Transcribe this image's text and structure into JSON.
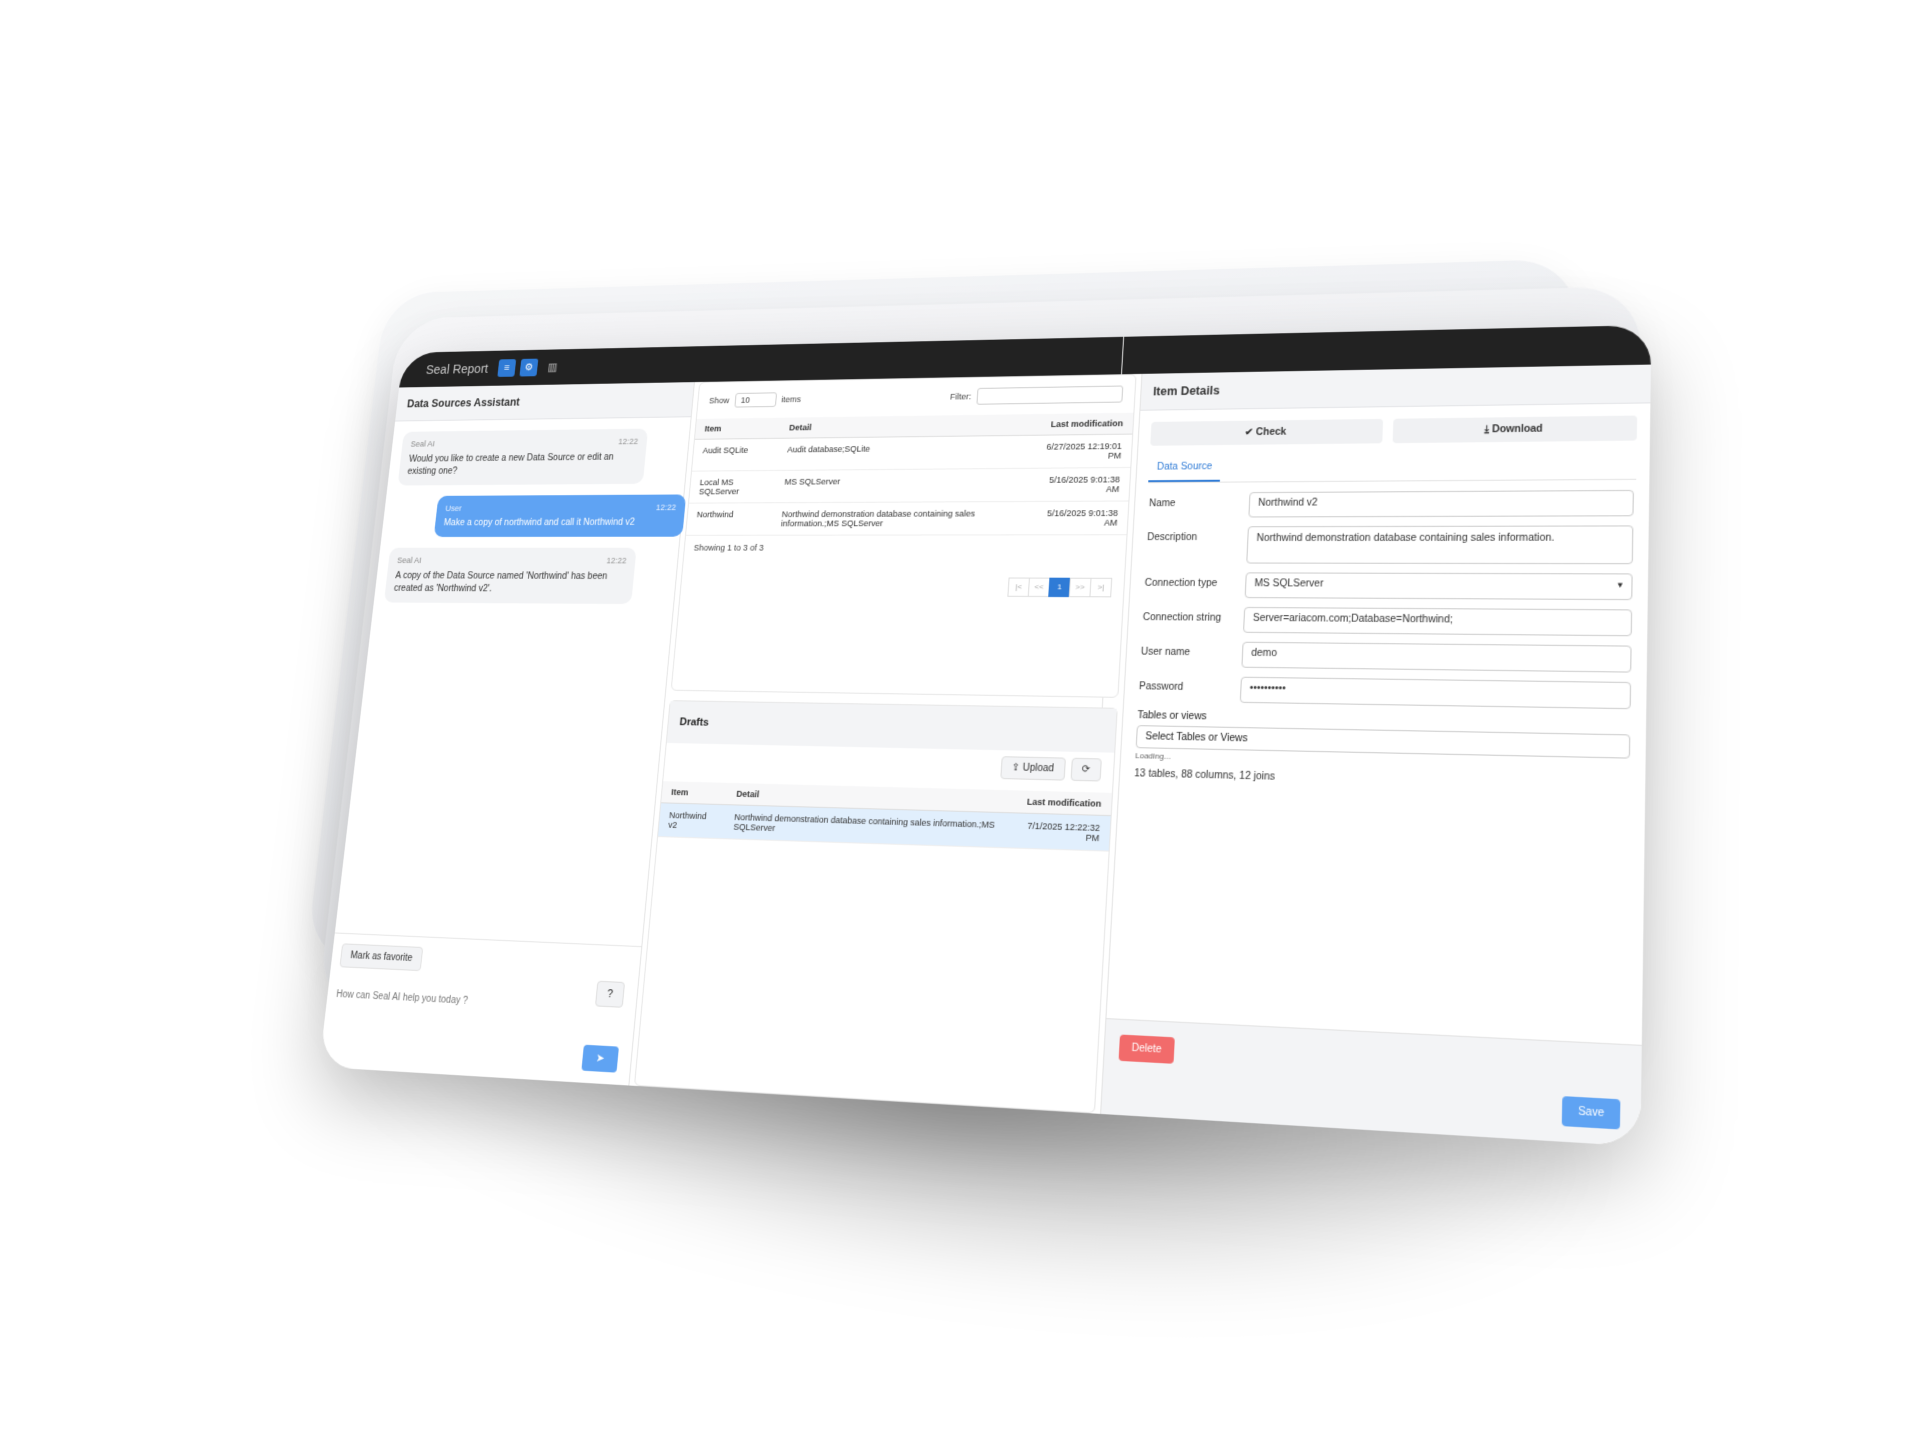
{
  "app": {
    "title": "Seal Report",
    "topbar_buttons": [
      "≡",
      "⚙"
    ],
    "topbar_chart_icon": "bar-chart-icon",
    "right_icons": [
      "info-icon",
      "logout-icon"
    ]
  },
  "assistant": {
    "title": "Data Sources Assistant",
    "messages": [
      {
        "who": "Seal AI",
        "time": "12:22",
        "text": "Would you like to create a new Data Source or edit an existing one?"
      },
      {
        "who": "User",
        "time": "12:22",
        "text": "Make a copy of northwind and call it Northwind v2"
      },
      {
        "who": "Seal AI",
        "time": "12:22",
        "text": "A copy of the Data Source named 'Northwind' has been created as 'Northwind v2'."
      }
    ],
    "favorite_label": "Mark as favorite",
    "prompt_placeholder": "How can Seal AI help you today ?",
    "help_icon": "?",
    "send_icon": "➤"
  },
  "sources": {
    "show_label": "Show",
    "page_size": "10",
    "items_label": "items",
    "filter_label": "Filter:",
    "columns": [
      "Item",
      "Detail",
      "Last modification"
    ],
    "rows": [
      {
        "item": "Audit SQLite",
        "detail": "Audit database;SQLite",
        "modified": "6/27/2025 12:19:01 PM"
      },
      {
        "item": "Local MS SQLServer",
        "detail": "MS SQLServer",
        "modified": "5/16/2025 9:01:38 AM"
      },
      {
        "item": "Northwind",
        "detail": "Northwind demonstration database containing sales information.;MS SQLServer",
        "modified": "5/16/2025 9:01:38 AM"
      }
    ],
    "showing": "Showing 1 to 3 of 3",
    "pager": [
      "|<",
      "<<",
      "1",
      ">>",
      ">|"
    ]
  },
  "drafts": {
    "title": "Drafts",
    "upload_label": "Upload",
    "refresh_icon": "⟳",
    "columns": [
      "Item",
      "Detail",
      "Last modification"
    ],
    "rows": [
      {
        "item": "Northwind v2",
        "detail": "Northwind demonstration database containing sales information.;MS SQLServer",
        "modified": "7/1/2025 12:22:32 PM"
      }
    ]
  },
  "details": {
    "title": "Item Details",
    "check_label": "Check",
    "download_label": "Download",
    "tab_label": "Data Source",
    "fields": {
      "name_label": "Name",
      "name_value": "Northwind v2",
      "desc_label": "Description",
      "desc_value": "Northwind demonstration database containing sales information.",
      "conn_type_label": "Connection type",
      "conn_type_value": "MS SQLServer",
      "conn_string_label": "Connection string",
      "conn_string_value": "Server=ariacom.com;Database=Northwind;",
      "user_label": "User name",
      "user_value": "demo",
      "password_label": "Password",
      "password_value": "••••••••••",
      "tables_label": "Tables or views",
      "tables_placeholder": "Select Tables or Views",
      "loading": "Loading...",
      "stats": "13 tables, 88 columns, 12 joins"
    },
    "delete_label": "Delete",
    "save_label": "Save"
  },
  "colors": {
    "accent": "#2f7bd6",
    "user_bubble": "#5fa3f3",
    "danger": "#f26b6b",
    "topbar": "#222222"
  }
}
